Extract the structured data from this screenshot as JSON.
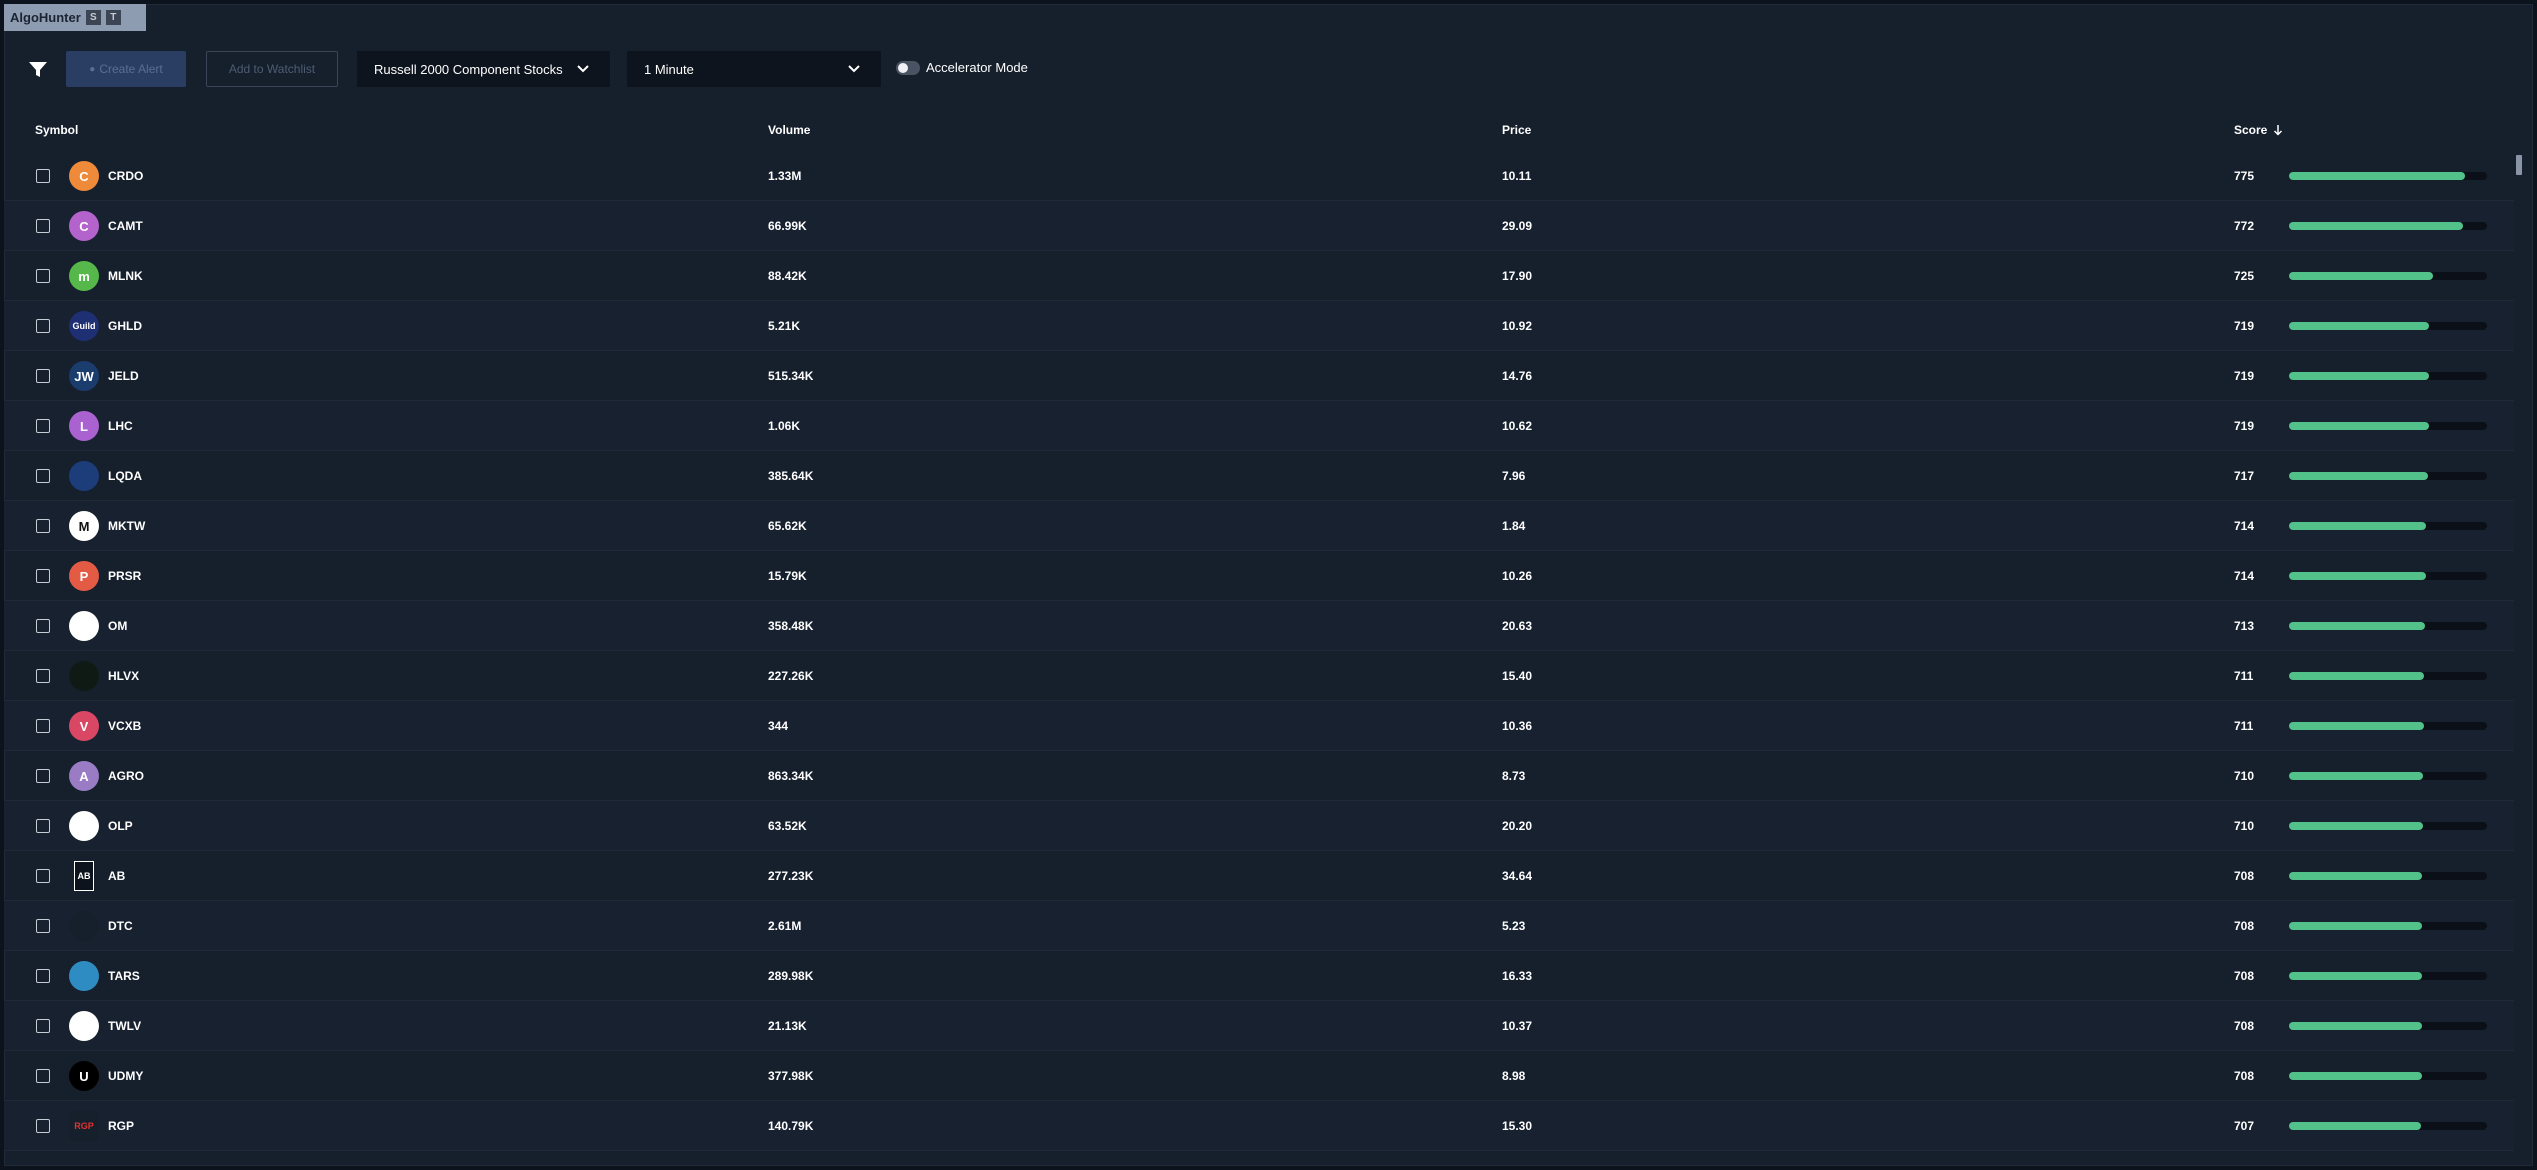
{
  "app": {
    "title": "AlgoHunter",
    "badges": [
      "S",
      "T"
    ]
  },
  "toolbar": {
    "create_alert_label": "Create Alert",
    "add_watchlist_label": "Add to Watchlist",
    "universe_value": "Russell 2000 Component Stocks",
    "interval_value": "1 Minute",
    "accelerator_label": "Accelerator Mode",
    "accelerator_on": false
  },
  "table": {
    "columns": {
      "symbol": "Symbol",
      "volume": "Volume",
      "price": "Price",
      "score": "Score"
    },
    "sort": {
      "column": "score",
      "direction": "descending"
    },
    "score_bar_max": 800,
    "rows": [
      {
        "symbol": "CRDO",
        "volume": "1.33M",
        "price": "10.11",
        "score": "775",
        "score_value": 775,
        "logo_text": "C",
        "logo_color": "#ee8a3a",
        "logo_icon": "letter-c-icon"
      },
      {
        "symbol": "CAMT",
        "volume": "66.99K",
        "price": "29.09",
        "score": "772",
        "score_value": 772,
        "logo_text": "C",
        "logo_color": "#b463cc",
        "logo_icon": "letter-c-icon"
      },
      {
        "symbol": "MLNK",
        "volume": "88.42K",
        "price": "17.90",
        "score": "725",
        "score_value": 725,
        "logo_text": "m",
        "logo_color": "#56b84a",
        "logo_icon": "meridianlink-m-icon"
      },
      {
        "symbol": "GHLD",
        "volume": "5.21K",
        "price": "10.92",
        "score": "719",
        "score_value": 719,
        "logo_text": "Guild",
        "logo_color": "#1f2f74",
        "logo_icon": "guild-logo-icon"
      },
      {
        "symbol": "JELD",
        "volume": "515.34K",
        "price": "14.76",
        "score": "719",
        "score_value": 719,
        "logo_text": "JW",
        "logo_color": "#1b3d6e",
        "logo_icon": "jeldwen-logo-icon"
      },
      {
        "symbol": "LHC",
        "volume": "1.06K",
        "price": "10.62",
        "score": "719",
        "score_value": 719,
        "logo_text": "L",
        "logo_color": "#a962cf",
        "logo_icon": "letter-l-icon"
      },
      {
        "symbol": "LQDA",
        "volume": "385.64K",
        "price": "7.96",
        "score": "717",
        "score_value": 717,
        "logo_text": "",
        "logo_color": "#1d3c7a",
        "logo_icon": "liquidia-logo-icon"
      },
      {
        "symbol": "MKTW",
        "volume": "65.62K",
        "price": "1.84",
        "score": "714",
        "score_value": 714,
        "logo_text": "M",
        "logo_color": "#ffffff",
        "logo_icon": "marketwise-m-icon"
      },
      {
        "symbol": "PRSR",
        "volume": "15.79K",
        "price": "10.26",
        "score": "714",
        "score_value": 714,
        "logo_text": "P",
        "logo_color": "#e35b45",
        "logo_icon": "letter-p-icon"
      },
      {
        "symbol": "OM",
        "volume": "358.48K",
        "price": "20.63",
        "score": "713",
        "score_value": 713,
        "logo_text": "",
        "logo_color": "#ffffff",
        "logo_icon": "outset-ring-icon"
      },
      {
        "symbol": "HLVX",
        "volume": "227.26K",
        "price": "15.40",
        "score": "711",
        "score_value": 711,
        "logo_text": "",
        "logo_color": "#0f1a14",
        "logo_icon": "hillevax-burst-icon"
      },
      {
        "symbol": "VCXB",
        "volume": "344",
        "price": "10.36",
        "score": "711",
        "score_value": 711,
        "logo_text": "V",
        "logo_color": "#d94764",
        "logo_icon": "letter-v-icon"
      },
      {
        "symbol": "AGRO",
        "volume": "863.34K",
        "price": "8.73",
        "score": "710",
        "score_value": 710,
        "logo_text": "A",
        "logo_color": "#9a7cc4",
        "logo_icon": "letter-a-icon"
      },
      {
        "symbol": "OLP",
        "volume": "63.52K",
        "price": "20.20",
        "score": "710",
        "score_value": 710,
        "logo_text": "",
        "logo_color": "#ffffff",
        "logo_icon": "olp-diamond-icon"
      },
      {
        "symbol": "AB",
        "volume": "277.23K",
        "price": "34.64",
        "score": "708",
        "score_value": 708,
        "logo_text": "AB",
        "logo_color": "#0d131d",
        "logo_icon": "alliancebernstein-logo-icon"
      },
      {
        "symbol": "DTC",
        "volume": "2.61M",
        "price": "5.23",
        "score": "708",
        "score_value": 708,
        "logo_text": "",
        "logo_color": "#161f2c",
        "logo_icon": "flame-icon"
      },
      {
        "symbol": "TARS",
        "volume": "289.98K",
        "price": "16.33",
        "score": "708",
        "score_value": 708,
        "logo_text": "",
        "logo_color": "#2f8cc2",
        "logo_icon": "tarsus-logo-icon"
      },
      {
        "symbol": "TWLV",
        "volume": "21.13K",
        "price": "10.37",
        "score": "708",
        "score_value": 708,
        "logo_text": "",
        "logo_color": "#ffffff",
        "logo_icon": "twelve-seas-logo-icon"
      },
      {
        "symbol": "UDMY",
        "volume": "377.98K",
        "price": "8.98",
        "score": "708",
        "score_value": 708,
        "logo_text": "U",
        "logo_color": "#000000",
        "logo_icon": "udemy-logo-icon"
      },
      {
        "symbol": "RGP",
        "volume": "140.79K",
        "price": "15.30",
        "score": "707",
        "score_value": 707,
        "logo_text": "RGP",
        "logo_color": "#161f2c",
        "logo_icon": "rgp-logo-icon"
      }
    ]
  }
}
